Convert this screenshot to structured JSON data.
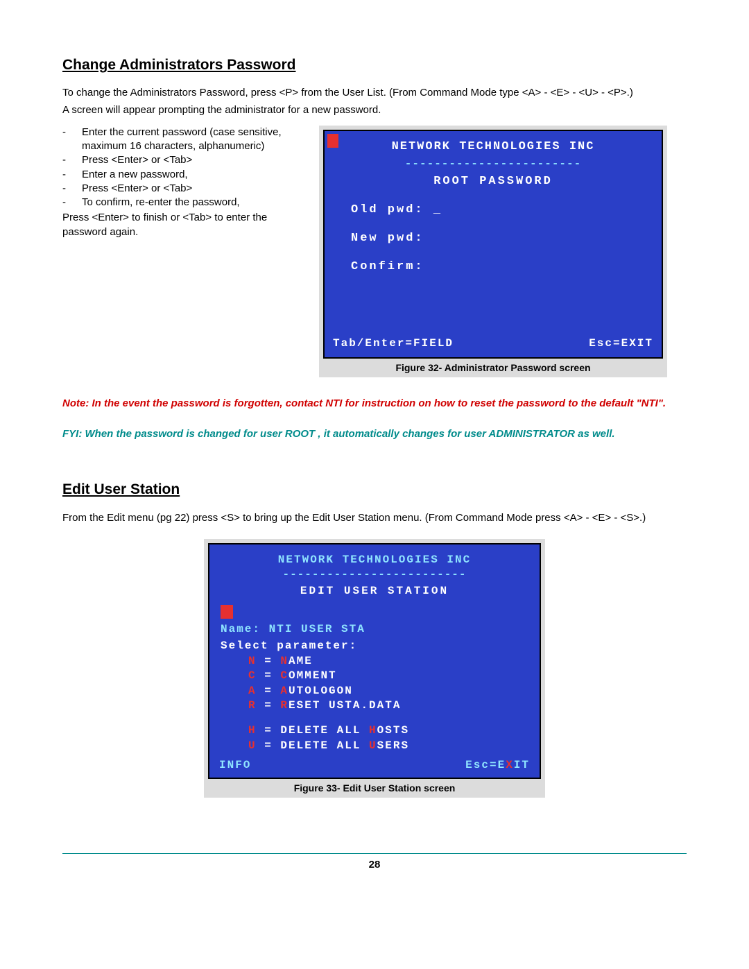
{
  "page_number": "28",
  "section1": {
    "title": "Change Administrators Password",
    "intro1": "To change the Administrators Password, press <P> from the User List. (From Command Mode type <A> - <E> - <U> - <P>.)",
    "intro2": "A screen will appear prompting the administrator for a new password.",
    "bullets": [
      "Enter the current password (case sensitive, maximum 16 characters, alphanumeric)",
      "Press <Enter> or <Tab>",
      "Enter a new password,",
      "Press <Enter> or <Tab>",
      "To confirm, re-enter the password,"
    ],
    "after1": "Press <Enter> to finish or <Tab> to enter the password again.",
    "figure_caption": "Figure 32- Administrator Password screen",
    "screen": {
      "company": "NETWORK TECHNOLOGIES INC",
      "dashes": "------------------------",
      "title": "ROOT PASSWORD",
      "old": "Old pwd: _",
      "new": "New pwd:",
      "confirm": "Confirm:",
      "footer_left": "Tab/Enter=FIELD",
      "footer_right": "Esc=EXIT"
    },
    "note_red": "Note:  In the event the password is forgotten, contact NTI for instruction on how to reset the password to the default \"NTI\".",
    "note_teal": "FYI:  When the password is changed for user ROOT ,  it automatically changes for user ADMINISTRATOR as well."
  },
  "section2": {
    "title": "Edit User Station",
    "intro": "From the Edit menu (pg 22) press <S>  to bring up the Edit User Station menu.  (From Command Mode press <A> - <E> - <S>.)",
    "figure_caption": "Figure 33- Edit User Station screen",
    "screen": {
      "company": "NETWORK TECHNOLOGIES INC",
      "dashes": "-------------------------",
      "title": "EDIT USER STATION",
      "name_line": "Name: NTI USER STA",
      "select_line": "Select parameter:",
      "items": [
        {
          "hot": "N",
          "eq": " = ",
          "pre": "",
          "hot2": "N",
          "rest": "AME"
        },
        {
          "hot": "C",
          "eq": " = ",
          "pre": "",
          "hot2": "C",
          "rest": "OMMENT"
        },
        {
          "hot": "A",
          "eq": " = ",
          "pre": "",
          "hot2": "A",
          "rest": "UTOLOGON"
        },
        {
          "hot": "R",
          "eq": " = ",
          "pre": "",
          "hot2": "R",
          "rest": "ESET USTA.DATA"
        }
      ],
      "items2": [
        {
          "hot": "H",
          "eq": " = DELETE ALL ",
          "hot2": "H",
          "rest": "OSTS"
        },
        {
          "hot": "U",
          "eq": " = DELETE ALL ",
          "hot2": "U",
          "rest": "SERS"
        }
      ],
      "footer_left": "INFO",
      "footer_right_pre": "Esc=E",
      "footer_right_hot": "X",
      "footer_right_post": "IT"
    }
  }
}
